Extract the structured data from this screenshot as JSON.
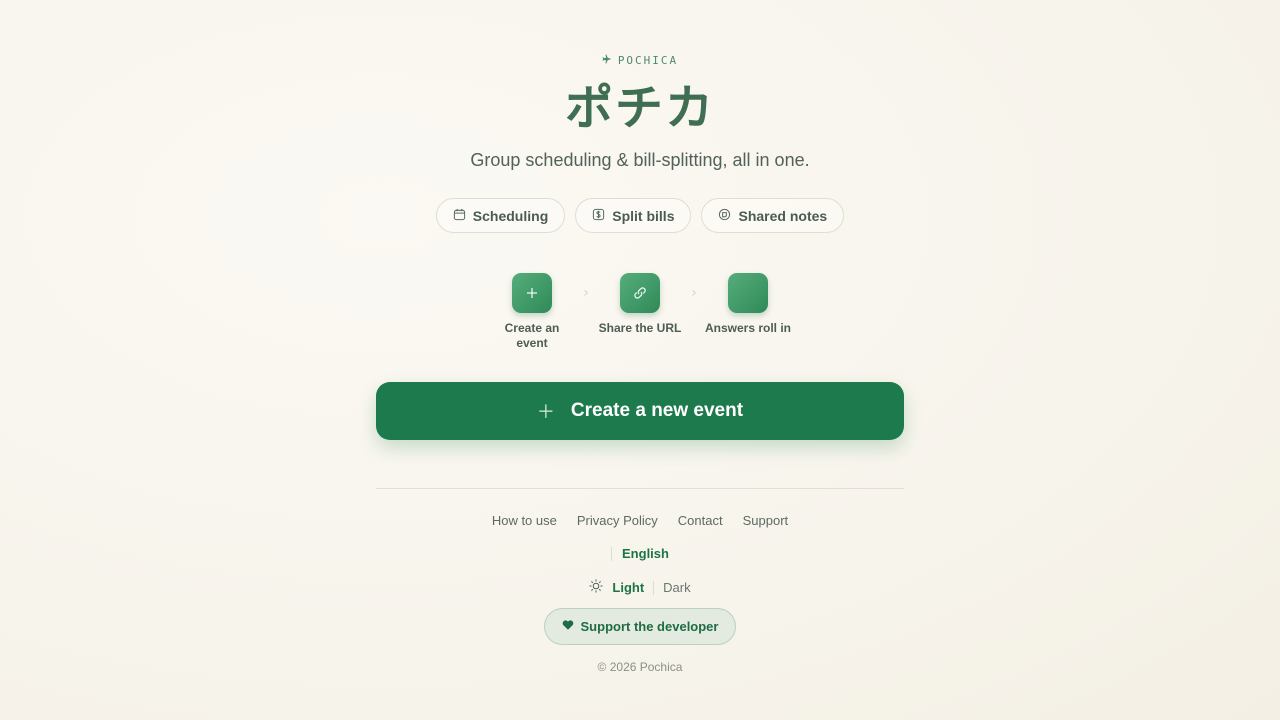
{
  "brand": {
    "label": "POCHICA",
    "icon": "airplane-icon"
  },
  "hero": {
    "title": "ポチカ",
    "tagline": "Group scheduling & bill-splitting, all in one."
  },
  "features": [
    {
      "label": "Scheduling",
      "icon": "calendar-icon"
    },
    {
      "label": "Split bills",
      "icon": "dollar-icon"
    },
    {
      "label": "Shared notes",
      "icon": "notes-icon"
    }
  ],
  "steps": [
    {
      "label": "Create an event",
      "icon": "plus-icon"
    },
    {
      "label": "Share the URL",
      "icon": "link-icon"
    },
    {
      "label": "Answers roll in",
      "icon": "inbox-icon"
    }
  ],
  "cta": {
    "label": "Create a new event",
    "icon": "plus-icon"
  },
  "footer": {
    "links": [
      "How to use",
      "Privacy Policy",
      "Contact",
      "Support"
    ],
    "language": "English",
    "theme": {
      "light": "Light",
      "dark": "Dark",
      "selected": "Light"
    },
    "support_label": "Support the developer",
    "copyright": "© 2026 Pochica"
  },
  "colors": {
    "accent": "#1c7a4c",
    "background": "#f8f5ee"
  }
}
